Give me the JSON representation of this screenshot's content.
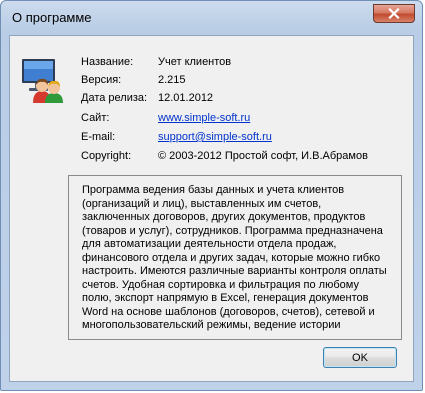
{
  "window": {
    "title": "О программе",
    "close_icon": "close-icon"
  },
  "about": {
    "icon": "clients-app-icon",
    "name": {
      "label": "Название:",
      "value": "Учет клиентов"
    },
    "version": {
      "label": "Версия:",
      "value": "2.215"
    },
    "release": {
      "label": "Дата релиза:",
      "value": "12.01.2012"
    },
    "site": {
      "label": "Сайт:",
      "value": "www.simple-soft.ru"
    },
    "email": {
      "label": "E-mail:",
      "value": "support@simple-soft.ru"
    },
    "copyright": {
      "label": "Copyright:",
      "value": "© 2003-2012 Простой софт, И.В.Абрамов"
    },
    "description": [
      "Программа ведения базы данных и учета клиентов",
      "(организаций и лиц), выставленных им счетов,",
      "заключенных договоров, других документов, продуктов",
      "(товаров и услуг), сотрудников. Программа предназначена",
      "для автоматизации деятельности отдела продаж,",
      "финансового отдела и других задач, которые можно гибко",
      "настроить. Имеются различные варианты контроля оплаты",
      "счетов. Удобная сортировка и фильтрация по любому",
      "полю, экспорт напрямую в Excel, генерация документов",
      "Word на основе шаблонов (договоров, счетов), сетевой и",
      "многопользовательский режимы, ведение истории"
    ]
  },
  "buttons": {
    "ok": "OK"
  },
  "colors": {
    "title_bar": "#b9cde6",
    "client_bg": "#f0f0f0",
    "link": "#0033cc",
    "close_button": "#c24a2f"
  }
}
